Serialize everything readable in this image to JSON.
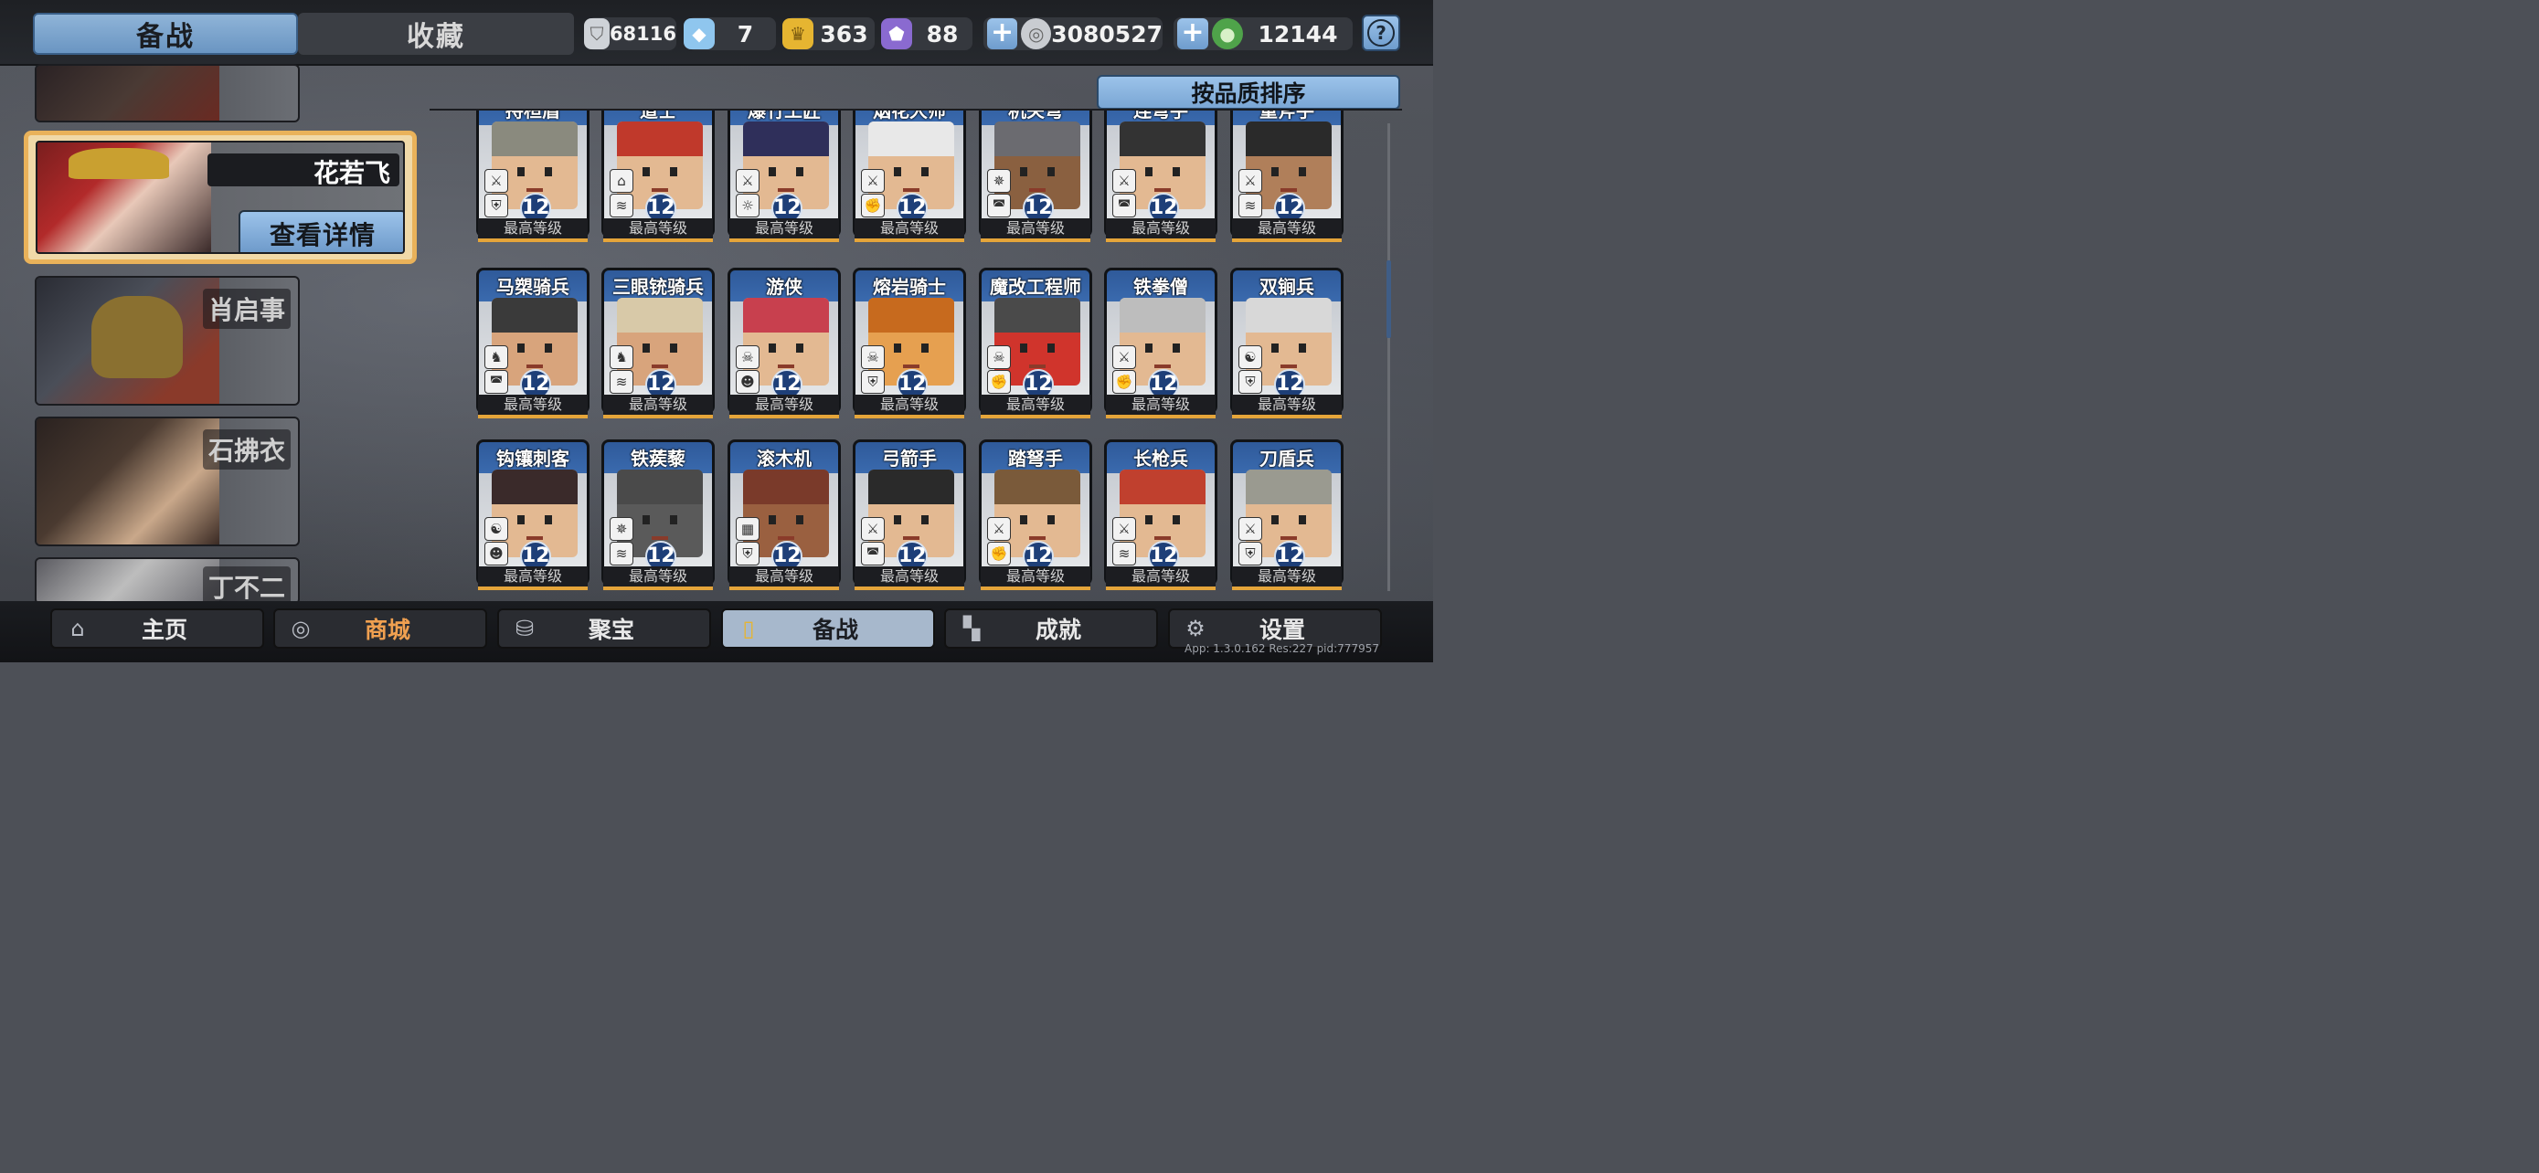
{
  "tabs": [
    {
      "label": "备战",
      "active": true
    },
    {
      "label": "收藏",
      "active": false
    }
  ],
  "resources": [
    {
      "icon": "silver-shield-icon",
      "value": "68116",
      "color": "#cfd3d8"
    },
    {
      "icon": "blue-crystal-icon",
      "value": "7",
      "color": "#8fc6ee"
    },
    {
      "icon": "gold-trophy-icon",
      "value": "363",
      "color": "#e6b531"
    },
    {
      "icon": "purple-crystal-icon",
      "value": "88",
      "color": "#8a6ad0"
    },
    {
      "icon": "silver-coin-icon",
      "value": "3080527",
      "color": "#c9ccd1",
      "plus": true
    },
    {
      "icon": "jade-coin-icon",
      "value": "12144",
      "color": "#4fa34a",
      "plus": true
    }
  ],
  "help_label": "?",
  "sort_label": "按品质排序",
  "selected_hero": {
    "name": "花若飞",
    "detail_label": "查看详情"
  },
  "heroes": [
    {
      "name": ""
    },
    {
      "name": "肖启事"
    },
    {
      "name": "石拂衣"
    },
    {
      "name": "丁不二"
    }
  ],
  "max_level_label": "最高等级",
  "units": [
    [
      {
        "name": "持桓盾",
        "level": "12",
        "abilities": [
          "sword-icon",
          "shield-icon"
        ],
        "hair": "#8a8a7e",
        "skin": "#e3b992"
      },
      {
        "name": "道士",
        "level": "12",
        "abilities": [
          "hat-icon",
          "wind-icon"
        ],
        "hair": "#c0392b",
        "skin": "#e3b992"
      },
      {
        "name": "爆竹工匠",
        "level": "12",
        "abilities": [
          "sword-icon",
          "sun-icon"
        ],
        "hair": "#2f2f5a",
        "skin": "#e3b992"
      },
      {
        "name": "烟花大师",
        "level": "12",
        "abilities": [
          "sword-icon",
          "fist-icon"
        ],
        "hair": "#e8e8e8",
        "skin": "#e3b992"
      },
      {
        "name": "机关弩",
        "level": "12",
        "abilities": [
          "web-icon",
          "helmet-icon"
        ],
        "hair": "#6b6b70",
        "skin": "#8a6040"
      },
      {
        "name": "连弩手",
        "level": "12",
        "abilities": [
          "sword-icon",
          "helmet-icon"
        ],
        "hair": "#333333",
        "skin": "#e3b992"
      },
      {
        "name": "重斧手",
        "level": "12",
        "abilities": [
          "sword-icon",
          "wind-icon"
        ],
        "hair": "#2a2a2a",
        "skin": "#b07f5a"
      }
    ],
    [
      {
        "name": "马槊骑兵",
        "level": "12",
        "abilities": [
          "horse-icon",
          "helmet-icon"
        ],
        "hair": "#3a3a3a",
        "skin": "#d8a47c"
      },
      {
        "name": "三眼铳骑兵",
        "level": "12",
        "abilities": [
          "horse-icon",
          "wind-icon"
        ],
        "hair": "#d8c9a8",
        "skin": "#d8a47c"
      },
      {
        "name": "游侠",
        "level": "12",
        "abilities": [
          "skull-icon",
          "person-icon"
        ],
        "hair": "#c8404e",
        "skin": "#e3b992"
      },
      {
        "name": "熔岩骑士",
        "level": "12",
        "abilities": [
          "skull-icon",
          "shield-icon"
        ],
        "hair": "#c76a1e",
        "skin": "#e6a050"
      },
      {
        "name": "魔改工程师",
        "level": "12",
        "abilities": [
          "skull-icon",
          "fist-icon"
        ],
        "hair": "#4a4a4a",
        "skin": "#d0342c"
      },
      {
        "name": "铁拳僧",
        "level": "12",
        "abilities": [
          "sword-icon",
          "fist-icon"
        ],
        "hair": "#bdbdbd",
        "skin": "#e3b992"
      },
      {
        "name": "双锏兵",
        "level": "12",
        "abilities": [
          "yinyang-icon",
          "shield-icon"
        ],
        "hair": "#d8d8d8",
        "skin": "#e3b992"
      }
    ],
    [
      {
        "name": "钩镶刺客",
        "level": "12",
        "abilities": [
          "yinyang-icon",
          "person-icon"
        ],
        "hair": "#3a2a2a",
        "skin": "#e3b992"
      },
      {
        "name": "铁蒺藜",
        "level": "12",
        "abilities": [
          "web-icon",
          "wind-icon"
        ],
        "hair": "#4a4a4a",
        "skin": "#5a5a5a"
      },
      {
        "name": "滚木机",
        "level": "12",
        "abilities": [
          "wall-icon",
          "shield-icon"
        ],
        "hair": "#7a3a2a",
        "skin": "#9a6040"
      },
      {
        "name": "弓箭手",
        "level": "12",
        "abilities": [
          "sword-icon",
          "helmet-icon"
        ],
        "hair": "#2a2a2a",
        "skin": "#e3b992"
      },
      {
        "name": "踏弩手",
        "level": "12",
        "abilities": [
          "sword-icon",
          "fist-icon"
        ],
        "hair": "#7a5a3a",
        "skin": "#e3b992"
      },
      {
        "name": "长枪兵",
        "level": "12",
        "abilities": [
          "sword-icon",
          "wind-icon"
        ],
        "hair": "#c0402e",
        "skin": "#e3b992"
      },
      {
        "name": "刀盾兵",
        "level": "12",
        "abilities": [
          "sword-icon",
          "shield-icon"
        ],
        "hair": "#9a9a90",
        "skin": "#e3b992"
      }
    ]
  ],
  "nav": [
    {
      "label": "主页",
      "icon": "home-icon",
      "active": false
    },
    {
      "label": "商城",
      "icon": "coins-icon",
      "active": false,
      "highlight": true
    },
    {
      "label": "聚宝",
      "icon": "treasure-icon",
      "active": false
    },
    {
      "label": "备战",
      "icon": "cards-icon",
      "active": true
    },
    {
      "label": "成就",
      "icon": "achievement-icon",
      "active": false
    },
    {
      "label": "设置",
      "icon": "gear-icon",
      "active": false
    }
  ],
  "version": "App: 1.3.0.162 Res:227 pid:777957",
  "colors": {
    "accent_blue": "#8fb4d8",
    "gold": "#e9b25a",
    "shop_orange": "#f0a050"
  }
}
